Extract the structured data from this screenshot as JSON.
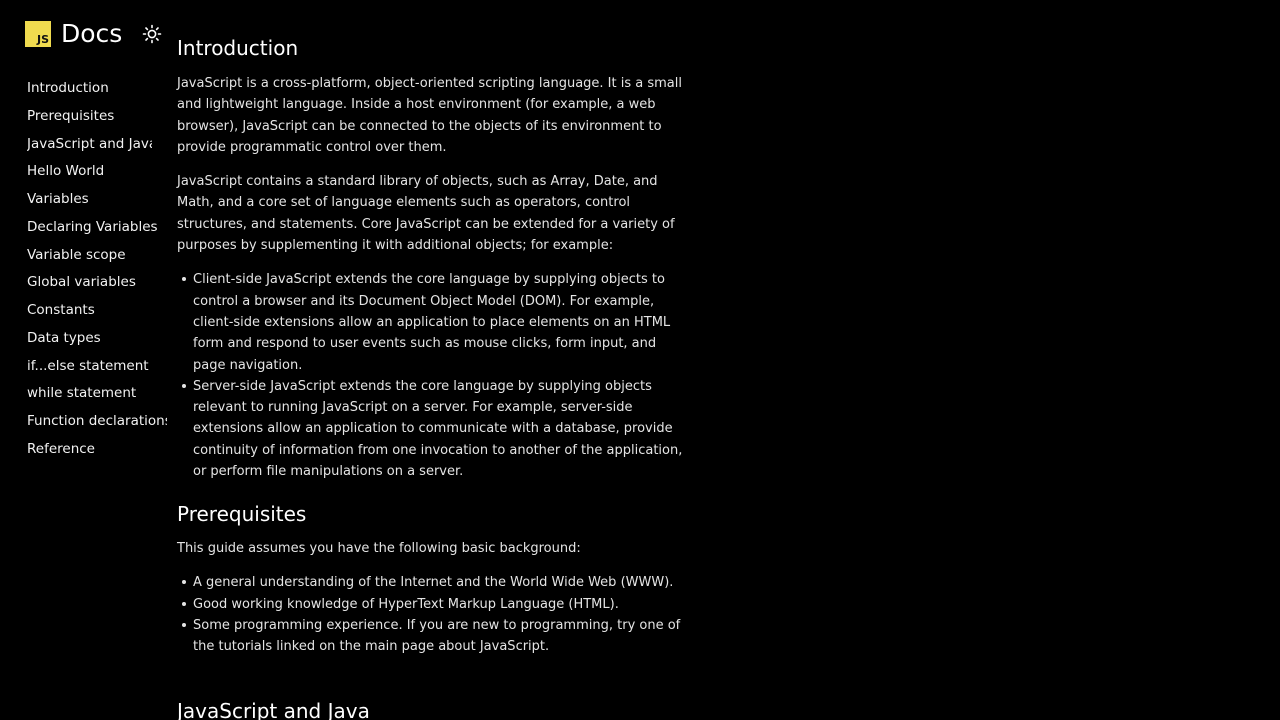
{
  "brand": {
    "logo_text": "JS",
    "title": "Docs"
  },
  "icons": {
    "theme_toggle": "sun-icon"
  },
  "sidebar": {
    "items": [
      {
        "label": "Introduction"
      },
      {
        "label": "Prerequisites"
      },
      {
        "label": "JavaScript and Java"
      },
      {
        "label": "Hello World"
      },
      {
        "label": "Variables"
      },
      {
        "label": "Declaring Variables"
      },
      {
        "label": "Variable scope"
      },
      {
        "label": "Global variables"
      },
      {
        "label": "Constants"
      },
      {
        "label": "Data types"
      },
      {
        "label": "if...else statement"
      },
      {
        "label": "while statement"
      },
      {
        "label": "Function declarations"
      },
      {
        "label": "Reference"
      }
    ]
  },
  "main": {
    "introduction": {
      "heading": "Introduction",
      "paragraph1": "JavaScript is a cross-platform, object-oriented scripting language. It is a small and lightweight language. Inside a host environment (for example, a web browser), JavaScript can be connected to the objects of its environment to provide programmatic control over them.",
      "paragraph2": "JavaScript contains a standard library of objects, such as Array, Date, and Math, and a core set of language elements such as operators, control structures, and statements. Core JavaScript can be extended for a variety of purposes by supplementing it with additional objects; for example:",
      "bullets": [
        "Client-side JavaScript extends the core language by supplying objects to control a browser and its Document Object Model (DOM). For example, client-side extensions allow an application to place elements on an HTML form and respond to user events such as mouse clicks, form input, and page navigation.",
        "Server-side JavaScript extends the core language by supplying objects relevant to running JavaScript on a server. For example, server-side extensions allow an application to communicate with a database, provide continuity of information from one invocation to another of the application, or perform file manipulations on a server."
      ]
    },
    "prerequisites": {
      "heading": "Prerequisites",
      "paragraph": "This guide assumes you have the following basic background:",
      "bullets": [
        "A general understanding of the Internet and the World Wide Web (WWW).",
        "Good working knowledge of HyperText Markup Language (HTML).",
        "Some programming experience. If you are new to programming, try one of the tutorials linked on the main page about JavaScript."
      ]
    },
    "javascript_and_java": {
      "heading": "JavaScript and Java"
    }
  },
  "colors": {
    "background": "#000000",
    "text": "#e8e8e8",
    "logo": "#f0db4f"
  }
}
